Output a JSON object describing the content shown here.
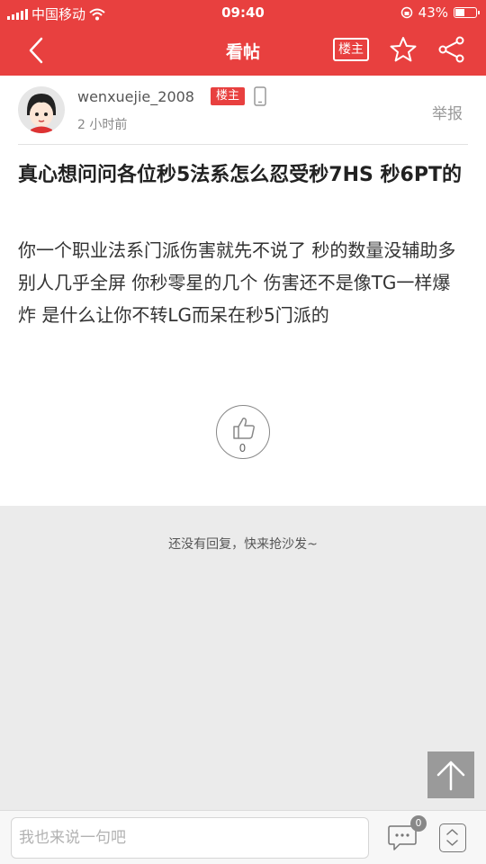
{
  "status_bar": {
    "carrier": "中国移动",
    "time": "09:40",
    "battery": "43%"
  },
  "nav": {
    "title": "看帖",
    "op_only_label": "楼主"
  },
  "post": {
    "username": "wenxuejie_2008",
    "op_badge": "楼主",
    "time": "2 小时前",
    "report_label": "举报",
    "title": "真心想问问各位秒5法系怎么忍受秒7HS 秒6PT的",
    "body": "你一个职业法系门派伤害就先不说了 秒的数量没辅助多 别人几乎全屏 你秒零星的几个 伤害还不是像TG一样爆炸 是什么让你不转LG而呆在秒5门派的",
    "like_count": "0"
  },
  "replies": {
    "empty_text": "还没有回复，快来抢沙发~"
  },
  "bottom_bar": {
    "input_placeholder": "我也来说一句吧",
    "comment_count": "0"
  },
  "colors": {
    "brand_red": "#e8403f",
    "background": "#ebebeb"
  },
  "icons": [
    "signal-icon",
    "wifi-icon",
    "lock-rotation-icon",
    "battery-icon",
    "back-icon",
    "star-icon",
    "share-icon",
    "phone-icon",
    "thumbs-up-icon",
    "arrow-up-icon",
    "comment-icon",
    "up-down-icon"
  ]
}
